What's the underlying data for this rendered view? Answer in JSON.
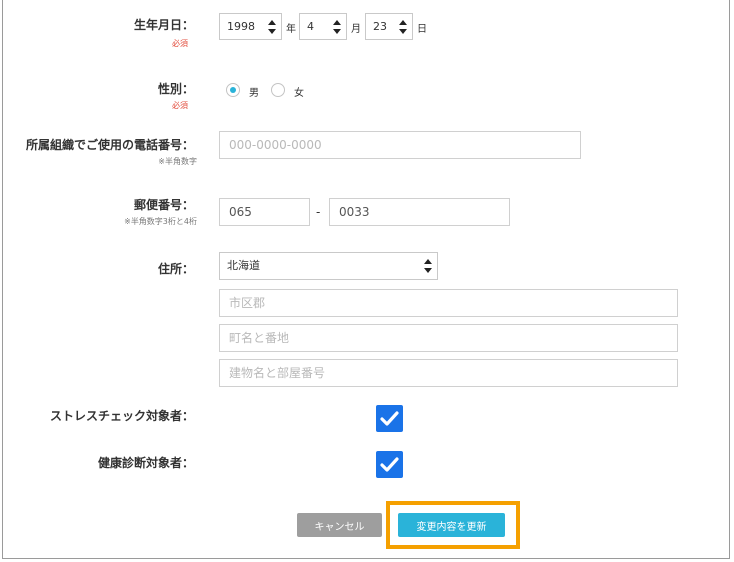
{
  "birthdate": {
    "label": "生年月日：",
    "required": "必須",
    "year": "1998",
    "year_unit": "年",
    "month": "4",
    "month_unit": "月",
    "day": "23",
    "day_unit": "日"
  },
  "gender": {
    "label": "性別：",
    "required": "必須",
    "options": [
      "男",
      "女"
    ],
    "selected": "男"
  },
  "phone": {
    "label": "所属組織でご使用の電話番号：",
    "note": "※半角数字",
    "placeholder": "000-0000-0000"
  },
  "postal": {
    "label": "郵便番号：",
    "note": "※半角数字3桁と4桁",
    "part1": "065",
    "separator": "-",
    "part2": "0033"
  },
  "address": {
    "label": "住所：",
    "prefecture": "北海道",
    "city_placeholder": "市区郡",
    "street_placeholder": "町名と番地",
    "building_placeholder": "建物名と部屋番号"
  },
  "stress_check": {
    "label": "ストレスチェック対象者：",
    "checked": true
  },
  "health_check": {
    "label": "健康診断対象者：",
    "checked": true
  },
  "buttons": {
    "cancel": "キャンセル",
    "update": "変更内容を更新"
  },
  "colors": {
    "accent": "#2ab3d9",
    "check": "#1a73e8",
    "highlight": "#f5a000",
    "cancel": "#9e9e9e",
    "required": "#e24b3b"
  }
}
